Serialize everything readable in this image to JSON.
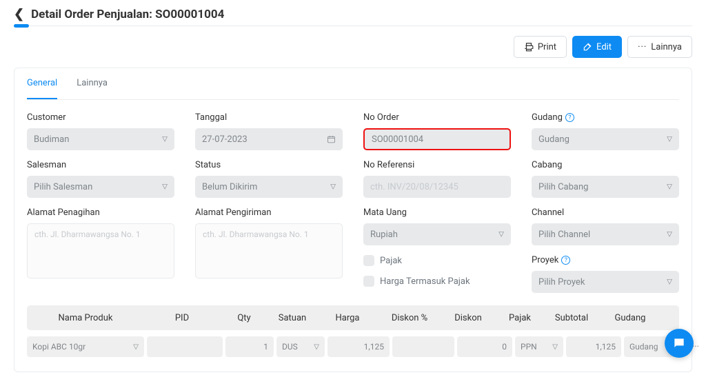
{
  "header": {
    "title": "Detail Order Penjualan: SO00001004"
  },
  "actions": {
    "print": "Print",
    "edit": "Edit",
    "more": "Lainnya"
  },
  "tabs": {
    "general": "General",
    "other": "Lainnya"
  },
  "form": {
    "customer_label": "Customer",
    "customer_value": "Budiman",
    "tanggal_label": "Tanggal",
    "tanggal_value": "27-07-2023",
    "noorder_label": "No Order",
    "noorder_value": "SO00001004",
    "gudang_label": "Gudang",
    "gudang_value": "Gudang",
    "salesman_label": "Salesman",
    "salesman_placeholder": "Pilih Salesman",
    "status_label": "Status",
    "status_value": "Belum Dikirim",
    "noref_label": "No Referensi",
    "noref_placeholder": "cth. INV/20/08/12345",
    "cabang_label": "Cabang",
    "cabang_placeholder": "Pilih Cabang",
    "alamat_tagih_label": "Alamat Penagihan",
    "alamat_tagih_placeholder": "cth. Jl. Dharmawangsa No. 1",
    "alamat_kirim_label": "Alamat Pengiriman",
    "alamat_kirim_placeholder": "cth. Jl. Dharmawangsa No. 1",
    "matauang_label": "Mata Uang",
    "matauang_value": "Rupiah",
    "pajak_check": "Pajak",
    "hargatermasuk_check": "Harga Termasuk Pajak",
    "channel_label": "Channel",
    "channel_placeholder": "Pilih Channel",
    "proyek_label": "Proyek",
    "proyek_placeholder": "Pilih Proyek"
  },
  "table": {
    "headers": {
      "produk": "Nama Produk",
      "pid": "PID",
      "qty": "Qty",
      "satuan": "Satuan",
      "harga": "Harga",
      "diskonp": "Diskon %",
      "diskon": "Diskon",
      "pajak": "Pajak",
      "subtotal": "Subtotal",
      "gudang": "Gudang"
    },
    "row": {
      "produk": "Kopi ABC 10gr",
      "pid": "",
      "qty": "1",
      "satuan": "DUS",
      "harga": "1,125",
      "diskonp": "",
      "diskon": "0",
      "pajak": "PPN",
      "subtotal": "1,125",
      "gudang": "Gudang"
    }
  }
}
